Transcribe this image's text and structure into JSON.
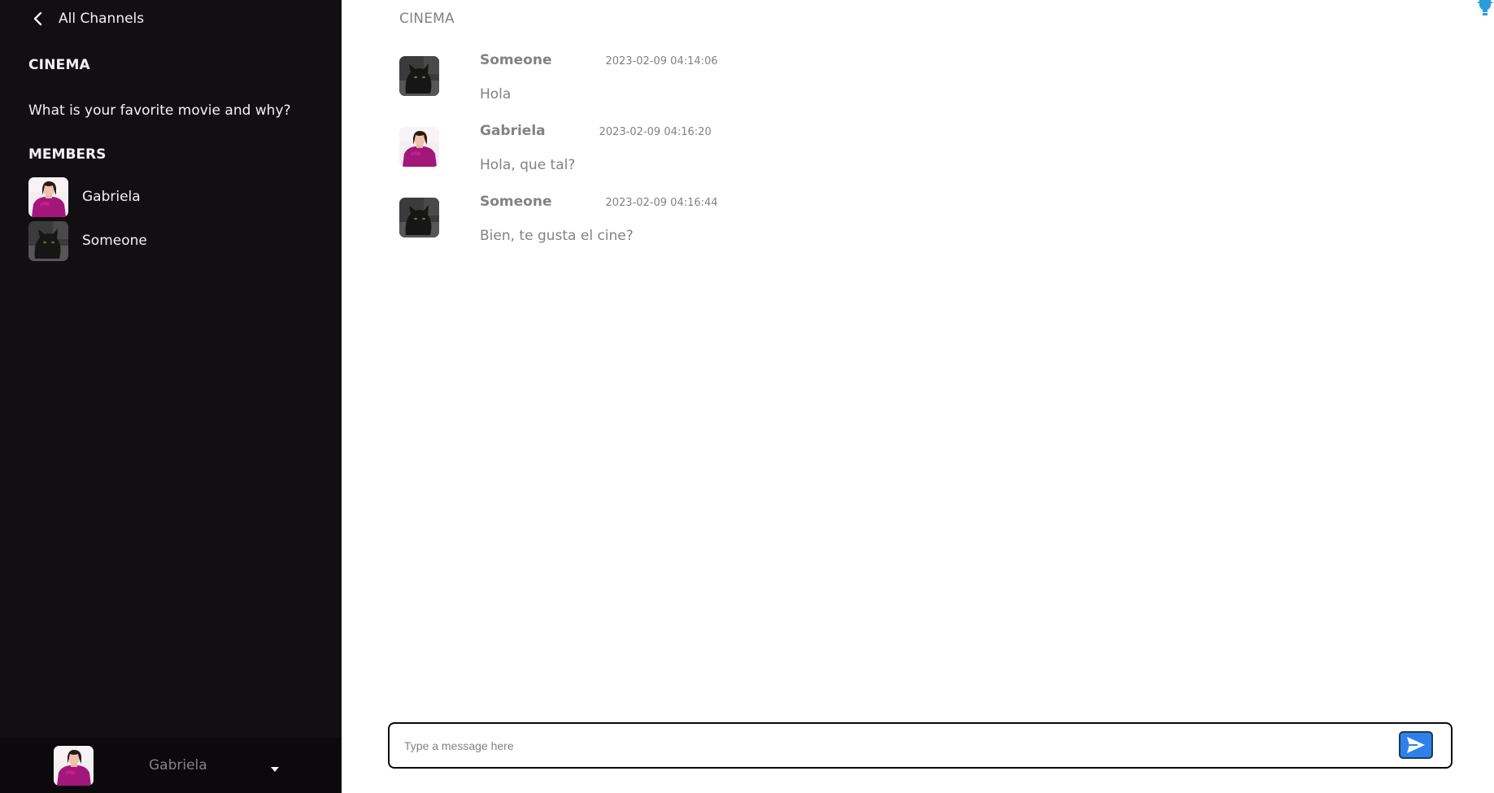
{
  "sidebar": {
    "back_label": "All Channels",
    "channel_name": "CINEMA",
    "channel_description": "What is your favorite movie and why?",
    "members_title": "MEMBERS",
    "members": [
      {
        "name": "Gabriela",
        "avatar": "woman-magenta-photo"
      },
      {
        "name": "Someone",
        "avatar": "black-cat-photo"
      }
    ],
    "current_user": {
      "name": "Gabriela",
      "avatar": "woman-magenta-photo"
    }
  },
  "main": {
    "channel_title": "CINEMA",
    "messages": [
      {
        "author": "Someone",
        "time": "2023-02-09 04:14:06",
        "text": "Hola",
        "avatar": "black-cat-photo"
      },
      {
        "author": "Gabriela",
        "time": "2023-02-09 04:16:20",
        "text": "Hola, que tal?",
        "avatar": "woman-magenta-photo"
      },
      {
        "author": "Someone",
        "time": "2023-02-09 04:16:44",
        "text": "Bien, te gusta el cine?",
        "avatar": "black-cat-photo"
      }
    ],
    "composer": {
      "placeholder": "Type a message here",
      "value": ""
    }
  },
  "icons": {
    "back": "chevron-left-icon",
    "send": "paper-plane-send-icon",
    "user_menu": "caret-down-icon",
    "corner": "lightbulb-icon"
  },
  "colors": {
    "sidebar_bg": "#120F13",
    "user_bar_bg": "#0B090C",
    "accent": "#2F80ED",
    "muted_text": "#828282",
    "sidebar_text": "#F2F2F2"
  }
}
